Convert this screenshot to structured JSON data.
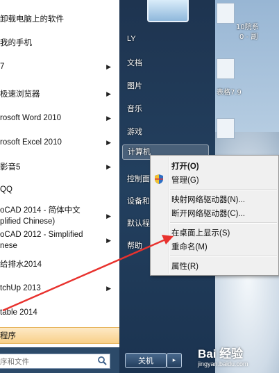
{
  "left_programs": [
    {
      "label": "卸载电脑上的软件",
      "has_arrow": false
    },
    {
      "label": "我的手机",
      "has_arrow": false
    },
    {
      "label": "7",
      "has_arrow": true
    },
    {
      "label": "极速浏览器",
      "has_arrow": true
    },
    {
      "label": "rosoft Word 2010",
      "has_arrow": true
    },
    {
      "label": "rosoft Excel 2010",
      "has_arrow": true
    },
    {
      "label": "影音5",
      "has_arrow": true
    },
    {
      "label": "QQ",
      "has_arrow": false
    },
    {
      "label": "oCAD 2014 - 简体中文\nplified Chinese)",
      "has_arrow": true
    },
    {
      "label": "oCAD 2012 - Simplified\nnese",
      "has_arrow": true
    },
    {
      "label": "给排水2014",
      "has_arrow": false
    },
    {
      "label": "tchUp 2013",
      "has_arrow": true
    },
    {
      "label": "table 2014",
      "has_arrow": false
    }
  ],
  "all_programs_label": "程序",
  "search_placeholder": "序和文件",
  "right_items": {
    "user": "LY",
    "documents": "文档",
    "pictures": "图片",
    "music": "音乐",
    "games": "游戏",
    "computer": "计算机",
    "control_panel": "控制面",
    "devices": "设备和",
    "default_programs": "默认程",
    "help": "帮助"
  },
  "shutdown_label": "关机",
  "shutdown_arrow": "▸",
  "context_menu": {
    "open": "打开(O)",
    "manage": "管理(G)",
    "map_drive": "映射网络驱动器(N)...",
    "disconnect_drive": "断开网络驱动器(C)...",
    "show_on_desktop": "在桌面上显示(S)",
    "rename": "重命名(M)",
    "properties": "属性(R)"
  },
  "desktop_labels": [
    "10院系",
    "0 - 副",
    "表格7.9"
  ],
  "watermark": {
    "logo": "Bai 经验",
    "sub": "jingyan.baidu.com"
  },
  "colors": {
    "annotation_arrow": "#e8322e",
    "all_programs_bg": "#f8d089"
  }
}
